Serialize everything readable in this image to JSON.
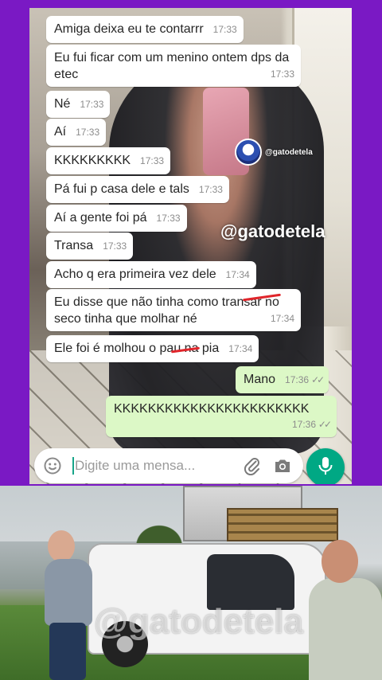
{
  "watermark": {
    "handle_small": "@gatodetela",
    "handle_big": "@gatodetela",
    "handle_photo": "@gatodetela"
  },
  "messages": [
    {
      "text": "Amiga deixa eu te contarrr",
      "time": "17:33",
      "dir": "in"
    },
    {
      "text": "Eu fui ficar com um menino ontem dps da etec",
      "time": "17:33",
      "dir": "in"
    },
    {
      "text": "Né",
      "time": "17:33",
      "dir": "in"
    },
    {
      "text": "Aí",
      "time": "17:33",
      "dir": "in"
    },
    {
      "text": "KKKKKKKKK",
      "time": "17:33",
      "dir": "in"
    },
    {
      "text": "Pá fui p casa dele e tals",
      "time": "17:33",
      "dir": "in"
    },
    {
      "text": "Aí a gente foi pá",
      "time": "17:33",
      "dir": "in"
    },
    {
      "text": "Transa",
      "time": "17:33",
      "dir": "in"
    },
    {
      "text": "Acho q era primeira vez dele",
      "time": "17:34",
      "dir": "in"
    },
    {
      "text": "Eu disse que não tinha como transar no seco tinha que molhar né",
      "time": "17:34",
      "dir": "in"
    },
    {
      "text": "Ele foi é molhou o pau na pia",
      "time": "17:34",
      "dir": "in"
    },
    {
      "text": "Mano",
      "time": "17:36",
      "dir": "out"
    },
    {
      "text": "KKKKKKKKKKKKKKKKKKKKKKK",
      "time": "17:36",
      "dir": "out"
    }
  ],
  "composer": {
    "placeholder": "Digite uma mensa..."
  },
  "icons": {
    "emoji": "emoji-icon",
    "attach": "paperclip-icon",
    "camera": "camera-icon",
    "mic": "microphone-icon",
    "read_receipt": "double-check-icon"
  },
  "colors": {
    "background": "#7a19c4",
    "incoming_bubble": "#ffffff",
    "outgoing_bubble": "#dcf8c6",
    "mic_button": "#00a884",
    "scribble": "#e0252b"
  }
}
